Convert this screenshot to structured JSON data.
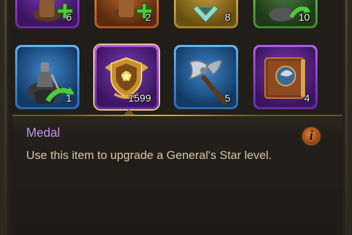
{
  "inventory": {
    "row1": [
      {
        "icon": "general-upgrade-icon",
        "count": "6",
        "rarity": "purple"
      },
      {
        "icon": "general-upgrade-icon",
        "count": "2",
        "rarity": "orange"
      },
      {
        "icon": "emblem-icon",
        "count": "8",
        "rarity": "gold"
      },
      {
        "icon": "cavalry-general-icon",
        "count": "10",
        "rarity": "green"
      }
    ],
    "row2": [
      {
        "icon": "cavalry-general-icon",
        "count": "1",
        "rarity": "blue"
      },
      {
        "icon": "medal-shield-icon",
        "count": "1599",
        "rarity": "purple",
        "selected": true
      },
      {
        "icon": "axe-icon",
        "count": "5",
        "rarity": "blue"
      },
      {
        "icon": "skill-book-icon",
        "count": "4",
        "rarity": "purple"
      }
    ]
  },
  "info": {
    "name": "Medal",
    "description": "Use this item to upgrade a General's Star level.",
    "info_icon_glyph": "i"
  },
  "colors": {
    "name": "#c88ff0",
    "description": "#d9c7a4",
    "panel_border": "#6a5522"
  }
}
